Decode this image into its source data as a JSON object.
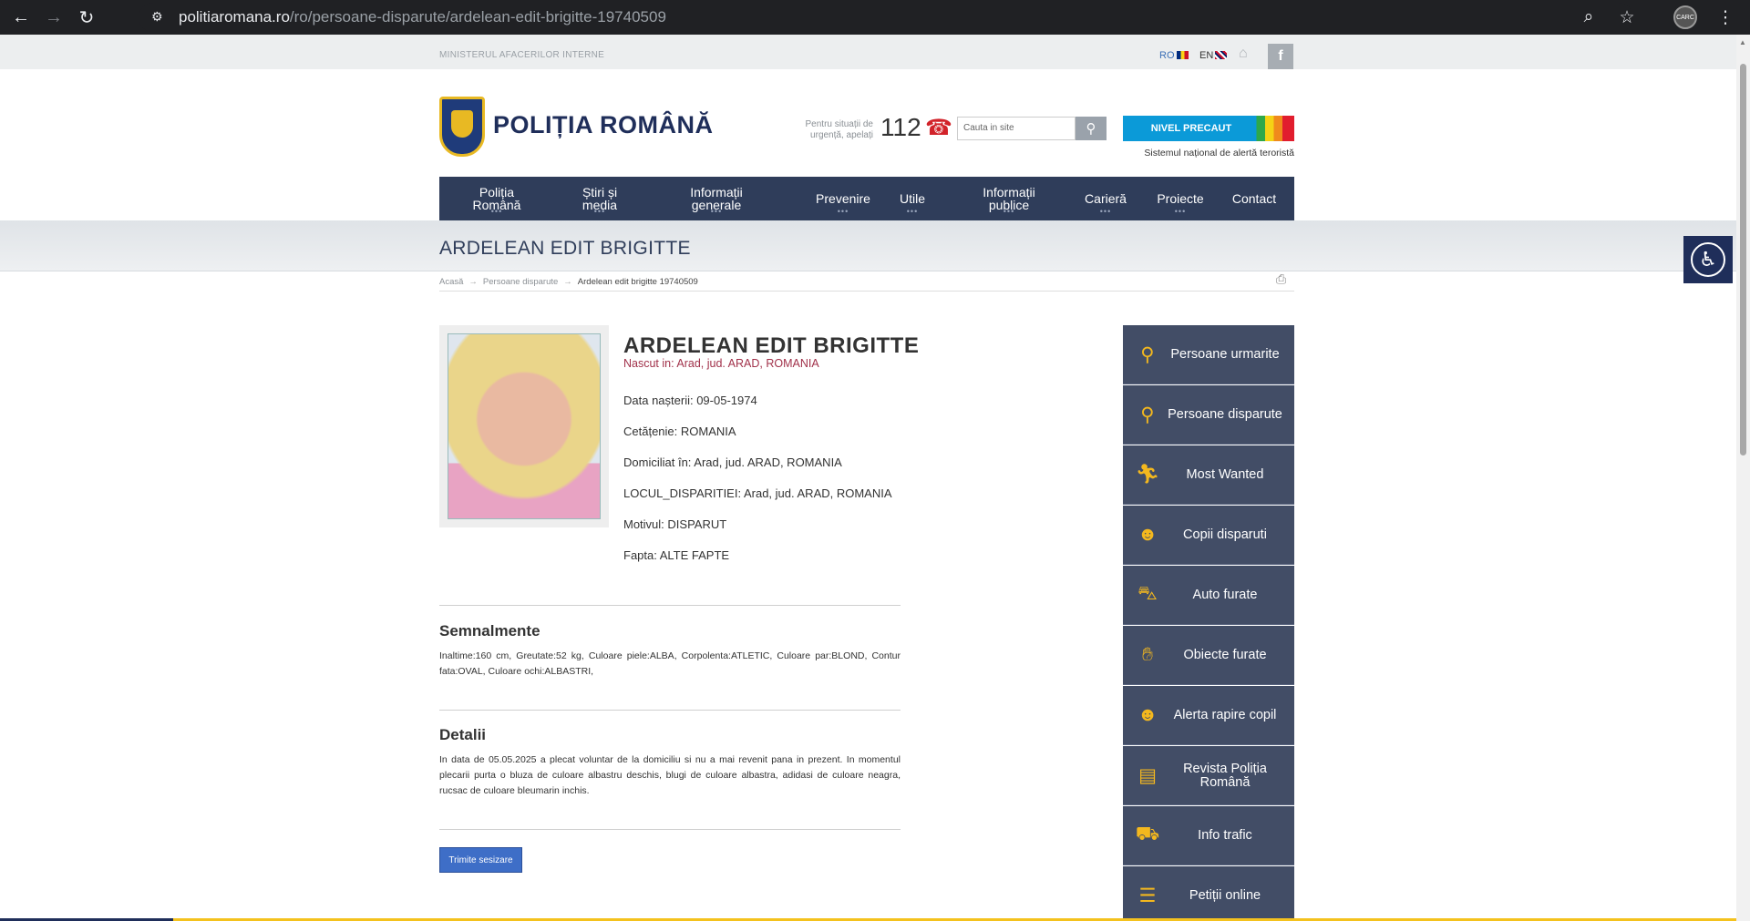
{
  "browser": {
    "url_host": "politiaromana.ro",
    "url_path": "/ro/persoane-disparute/ardelean-edit-brigitte-19740509",
    "profile_label": "CARC"
  },
  "topbar": {
    "ministry": "MINISTERUL AFACERILOR INTERNE",
    "lang_ro": "RO",
    "lang_en": "EN",
    "facebook": "f"
  },
  "header": {
    "logo_text": "POLIȚIA ROMÂNĂ",
    "urgent_text": "Pentru situații de urgență, apelați",
    "emergency_number": "112",
    "search_placeholder": "Cauta in site",
    "alert_label": "NIVEL PRECAUT",
    "alert_subtitle": "Sistemul național de alertă teroristă"
  },
  "nav": {
    "items": [
      {
        "label": "Poliția Română",
        "dots": "•••"
      },
      {
        "label": "Știri și media",
        "dots": "•••"
      },
      {
        "label": "Informații generale",
        "dots": "•••"
      },
      {
        "label": "Prevenire",
        "dots": "•••"
      },
      {
        "label": "Utile",
        "dots": "•••"
      },
      {
        "label": "Informații publice",
        "dots": "•••"
      },
      {
        "label": "Carieră",
        "dots": "•••"
      },
      {
        "label": "Proiecte",
        "dots": "•••"
      },
      {
        "label": "Contact",
        "dots": ""
      }
    ]
  },
  "page": {
    "title": "ARDELEAN EDIT BRIGITTE"
  },
  "breadcrumb": {
    "home": "Acasă",
    "section": "Persoane disparute",
    "current": "Ardelean edit brigitte 19740509",
    "separator": "→"
  },
  "person": {
    "name": "ARDELEAN EDIT BRIGITTE",
    "birthplace": "Nascut in: Arad, jud. ARAD, ROMANIA",
    "fields": [
      "Data nașterii: 09-05-1974",
      "Cetățenie: ROMANIA",
      "Domiciliat în: Arad, jud. ARAD, ROMANIA",
      "LOCUL_DISPARITIEI: Arad, jud. ARAD, ROMANIA",
      "Motivul: DISPARUT",
      "Fapta: ALTE FAPTE"
    ]
  },
  "sections": {
    "semnalmente_title": "Semnalmente",
    "semnalmente_text": "Inaltime:160 cm, Greutate:52 kg, Culoare piele:ALBA, Corpolenta:ATLETIC, Culoare par:BLOND, Contur fata:OVAL, Culoare ochi:ALBASTRI,",
    "detalii_title": "Detalii",
    "detalii_text": "In data de 05.05.2025 a plecat voluntar de la domiciliu si nu a mai revenit pana in prezent. In momentul plecarii purta o bluza de culoare albastru deschis, blugi de culoare albastra, adidasi de culoare neagra, rucsac de culoare bleumarin inchis."
  },
  "actions": {
    "send_report": "Trimite sesizare"
  },
  "sidebar": {
    "items": [
      {
        "label": "Persoane urmarite",
        "icon": "search-person-icon"
      },
      {
        "label": "Persoane disparute",
        "icon": "search-person-icon"
      },
      {
        "label": "Most Wanted",
        "icon": "running-person-icon"
      },
      {
        "label": "Copii disparuti",
        "icon": "child-icon"
      },
      {
        "label": "Auto furate",
        "icon": "car-thief-icon"
      },
      {
        "label": "Obiecte furate",
        "icon": "hand-icon"
      },
      {
        "label": "Alerta rapire copil",
        "icon": "child-alert-icon"
      },
      {
        "label": "Revista Poliția Română",
        "icon": "magazine-icon"
      },
      {
        "label": "Info trafic",
        "icon": "traffic-car-icon"
      },
      {
        "label": "Petiții online",
        "icon": "petition-icon"
      }
    ]
  },
  "colors": {
    "nav_bg": "#2f3d5a",
    "sidebar_bg": "#424d66",
    "accent_yellow": "#f4b81e",
    "alert_blue": "#0b9ad8",
    "birthplace_red": "#a1314a",
    "button_blue": "#3e6ec7"
  }
}
